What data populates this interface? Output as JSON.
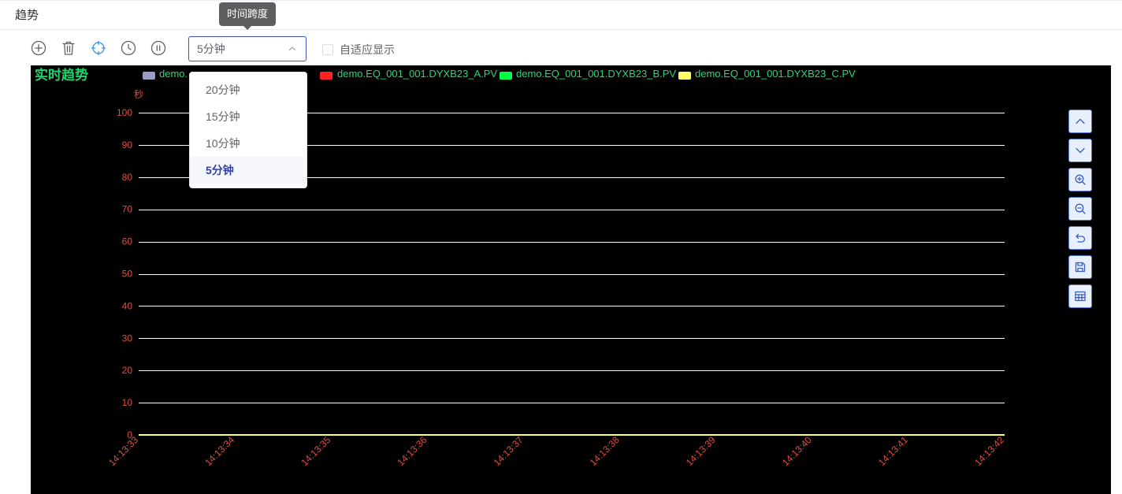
{
  "header": {
    "title": "趋势"
  },
  "toolbar": {
    "icons": [
      "plus-circle-icon",
      "trash-icon",
      "crosshair-icon",
      "clock-icon",
      "pause-circle-icon"
    ],
    "tooltip": "时间跨度",
    "time_span": {
      "value": "5分钟",
      "open": true,
      "options": [
        {
          "label": "20分钟",
          "selected": false
        },
        {
          "label": "15分钟",
          "selected": false
        },
        {
          "label": "10分钟",
          "selected": false
        },
        {
          "label": "5分钟",
          "selected": true
        }
      ]
    },
    "auto_fit": {
      "label": "自适应显示",
      "checked": false
    }
  },
  "side_buttons": [
    "chevron-up-icon",
    "chevron-down-icon",
    "zoom-in-icon",
    "zoom-out-icon",
    "undo-icon",
    "save-icon",
    "table-icon"
  ],
  "colors": {
    "accent": "#3d55b8",
    "crosshair_active": "#3a8ee6",
    "chart_background": "#000000",
    "title_green": "#22d46c",
    "legend_text": "#2bd67b",
    "axis_label_red": "#d9503f",
    "grid": "#ffffff",
    "side_button_bg": "#e8effd"
  },
  "chart_data": {
    "type": "line",
    "title": "实时趋势",
    "xlabel": "",
    "ylabel": "秒",
    "ylim": [
      0,
      100
    ],
    "yticks": [
      0,
      10,
      20,
      30,
      40,
      50,
      60,
      70,
      80,
      90,
      100
    ],
    "categories": [
      "14:13:33",
      "14:13:34",
      "14:13:35",
      "14:13:36",
      "14:13:37",
      "14:13:38",
      "14:13:39",
      "14:13:40",
      "14:13:41",
      "14:13:42"
    ],
    "series": [
      {
        "name": "demo.",
        "color": "#9b9bc8",
        "values": [
          0,
          0,
          0,
          0,
          0,
          0,
          0,
          0,
          0,
          0
        ]
      },
      {
        "name": "demo.EQ_001_001.DYXB23_A.PV",
        "color": "#ff2222",
        "values": [
          0,
          0,
          0,
          0,
          0,
          0,
          0,
          0,
          0,
          0
        ]
      },
      {
        "name": "demo.EQ_001_001.DYXB23_B.PV",
        "color": "#00ff44",
        "values": [
          0,
          0,
          0,
          0,
          0,
          0,
          0,
          0,
          0,
          0
        ]
      },
      {
        "name": "demo.EQ_001_001.DYXB23_C.PV",
        "color": "#ffff66",
        "values": [
          0,
          0,
          0,
          0,
          0,
          0,
          0,
          0,
          0,
          0
        ]
      }
    ],
    "grid": true,
    "legend_position": "top"
  }
}
